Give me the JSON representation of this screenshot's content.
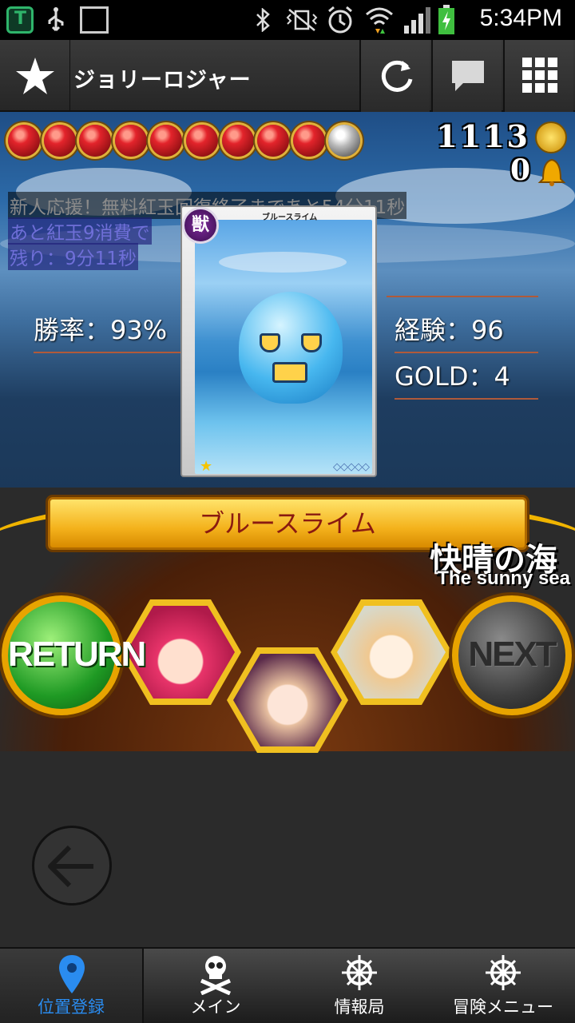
{
  "status_bar": {
    "time": "5:34PM"
  },
  "action_bar": {
    "title": "ジョリーロジャー",
    "icons": [
      "star-icon",
      "refresh-icon",
      "chat-icon",
      "grid-icon"
    ]
  },
  "hud": {
    "orbs_total": 10,
    "orbs_filled": 9,
    "coins": "1113",
    "bells": "0"
  },
  "notices": {
    "line1": "新人応援！無料紅玉回復終了まであと54分11秒",
    "line2": "あと紅玉9消費で",
    "line3": "残り：9分11秒"
  },
  "stats": {
    "win_rate": "勝率：93%",
    "experience": "経験：96",
    "gold": "GOLD：4"
  },
  "card": {
    "name": "ブルースライム",
    "type_badge": "獣",
    "rarity_star": "★",
    "gems": "◇◇◇◇◇"
  },
  "monster_name": "ブルースライム",
  "location": {
    "name_jp": "快晴の海",
    "name_en": "The sunny sea"
  },
  "buttons": {
    "return": "RETURN",
    "next": "NEXT"
  },
  "tabs": [
    {
      "label": "位置登録",
      "icon": "map-pin-icon",
      "active": true
    },
    {
      "label": "メイン",
      "icon": "skull-icon",
      "active": false
    },
    {
      "label": "情報局",
      "icon": "ship-wheel-icon",
      "active": false
    },
    {
      "label": "冒険メニュー",
      "icon": "ship-wheel-icon",
      "active": false
    }
  ],
  "colors": {
    "accent_blue": "#2a8cf0",
    "gold": "#f0b400",
    "return_green": "#1f9a24"
  }
}
